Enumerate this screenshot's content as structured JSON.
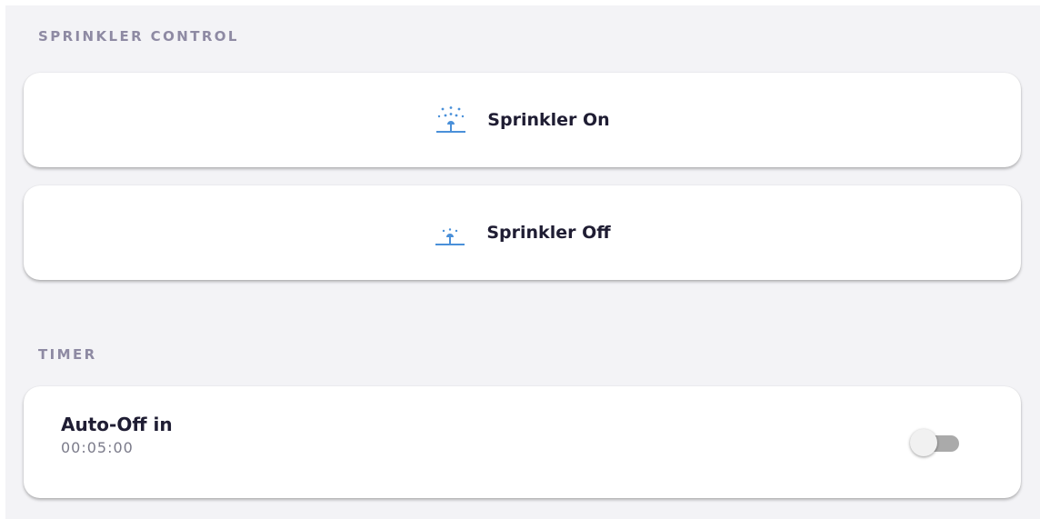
{
  "sprinkler_control": {
    "section_label": "SPRINKLER CONTROL",
    "on_button": {
      "label": "Sprinkler On",
      "icon": "sprinkler-on-icon"
    },
    "off_button": {
      "label": "Sprinkler Off",
      "icon": "sprinkler-off-icon"
    }
  },
  "timer": {
    "section_label": "TIMER",
    "auto_off": {
      "title": "Auto-Off in",
      "value": "00:05:00",
      "enabled": false
    }
  },
  "colors": {
    "icon_blue": "#4a90d9",
    "background": "#f3f3f6",
    "label_gray": "#8e8aa3",
    "text_dark": "#1f1d33"
  }
}
